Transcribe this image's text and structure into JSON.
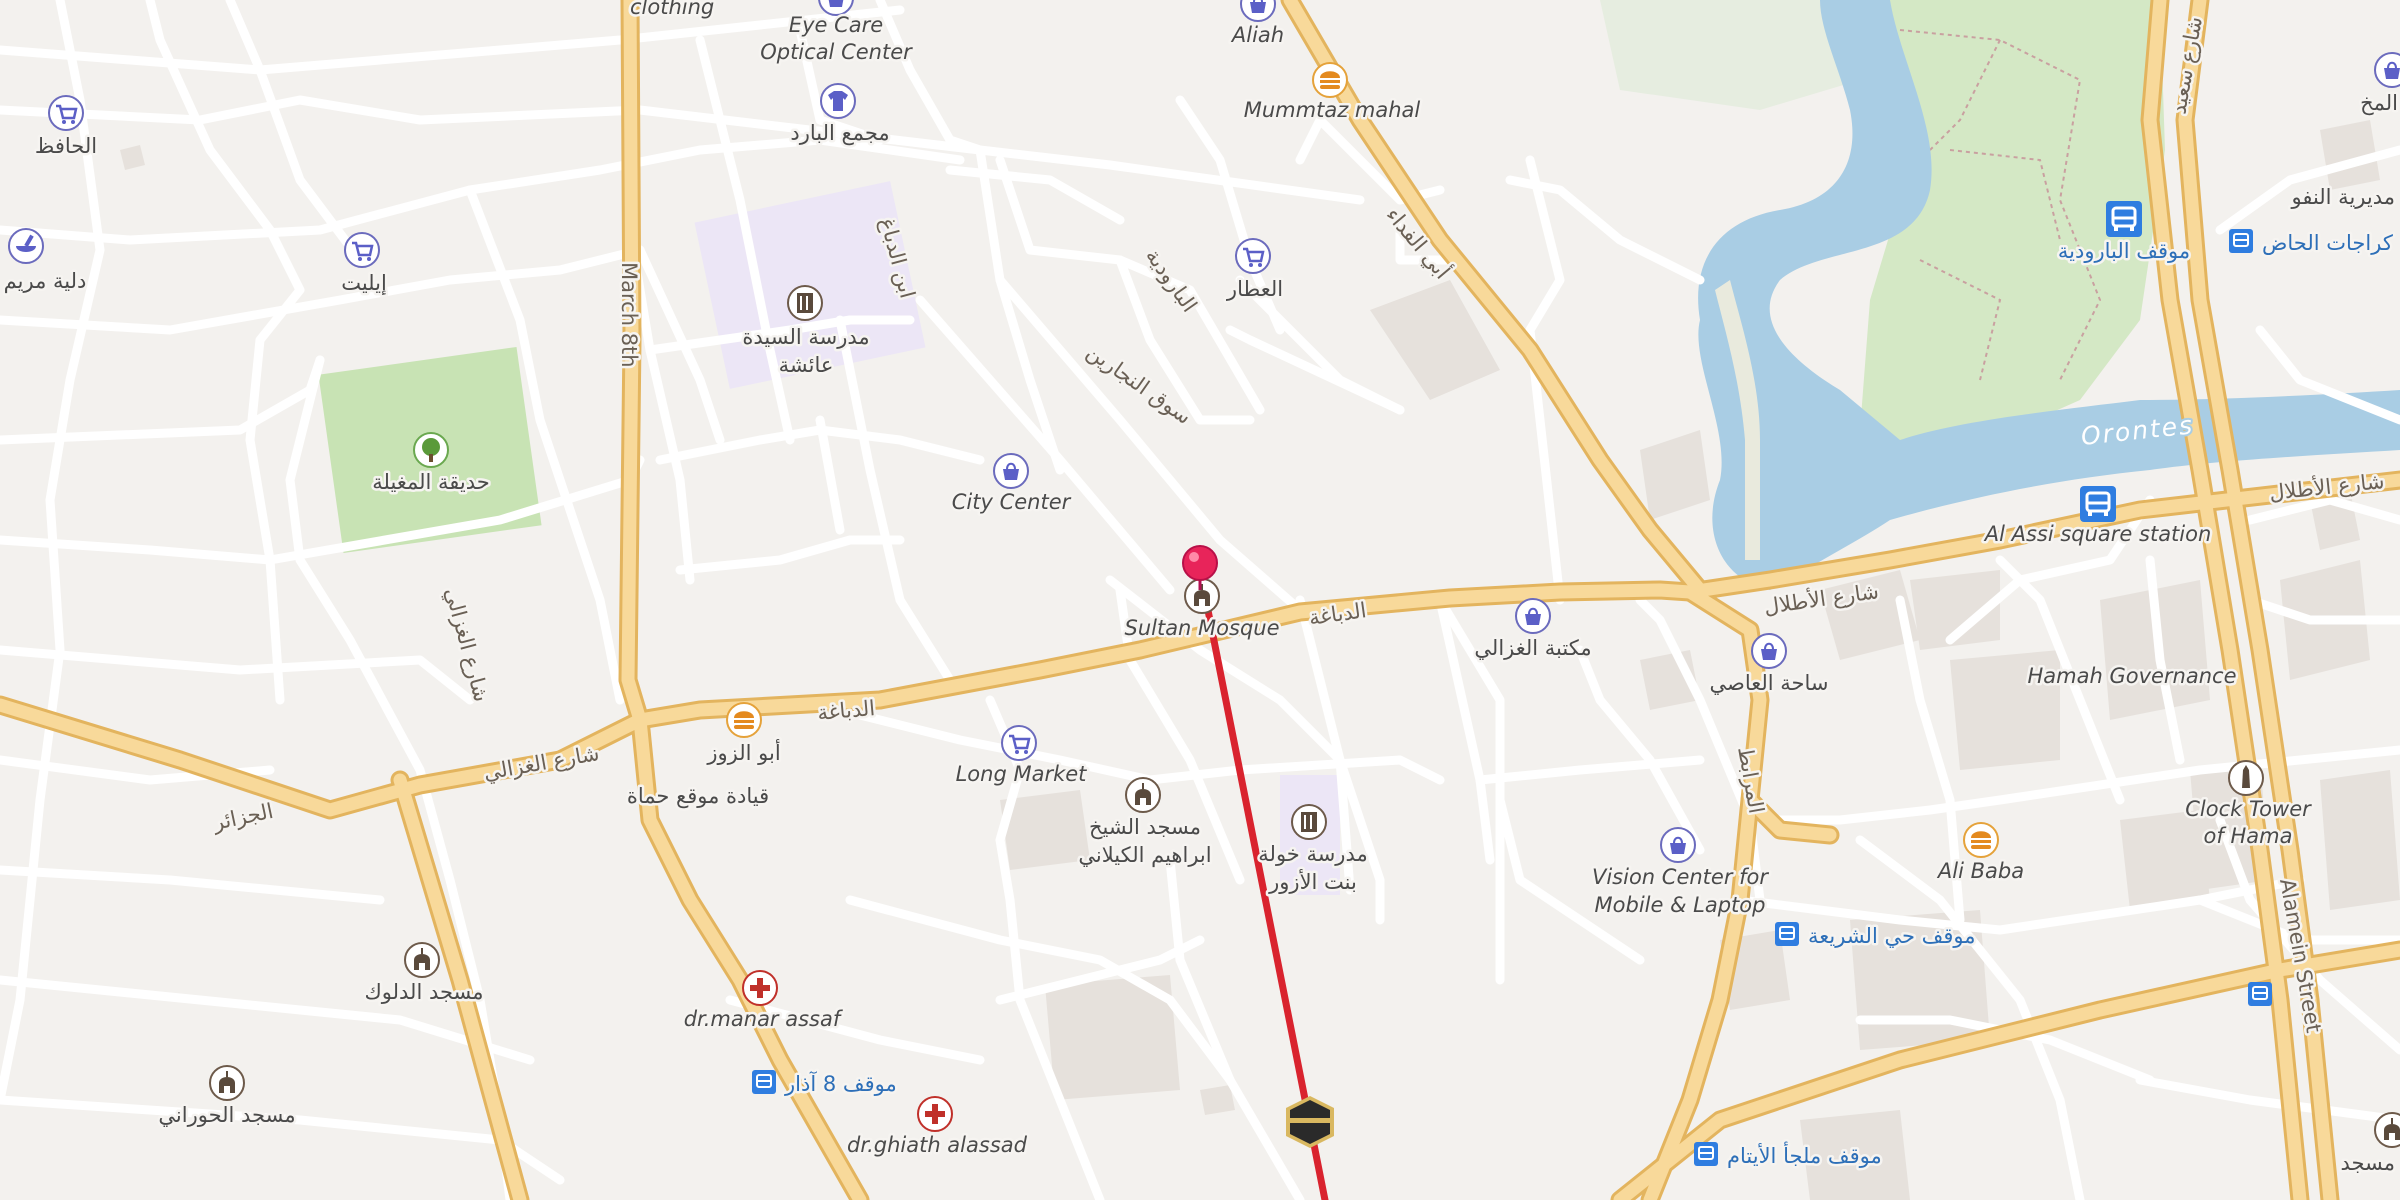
{
  "map": {
    "streets": {
      "march_8th": "March 8th",
      "alamein": "Alamein Street",
      "al_dabbagha_1": "الدباغة",
      "al_dabbagha_2": "الدباغة",
      "shari_al_ghazali": "شارع الغزالي",
      "al_jazair": "الجزائر",
      "shari_al_atlal_1": "شارع الأطلال",
      "shari_al_atlal_2": "شارع الأطلال",
      "suq_al_najjarin": "سوق النجارين",
      "al_marabit": "المرابط",
      "shari_al_ghazali_v": "شارع الغزالي",
      "abi_al_fida": "أبي الفداء",
      "al_barudiya": "البارودية",
      "bin_al_dabbagh": "ابن الدباغ",
      "shari_saeed": "شارع سعيد"
    },
    "water": {
      "orontes": "Orontes"
    },
    "pois": [
      {
        "id": "clothing",
        "label": "clothing",
        "icon": "shirt-icon"
      },
      {
        "id": "eye-care",
        "label": "Eye Care\nOptical Center",
        "icon": "shopping-bag-icon"
      },
      {
        "id": "aliah",
        "label": "Aliah",
        "icon": "shopping-bag-icon"
      },
      {
        "id": "mummtaz",
        "label": "Mummtaz mahal",
        "icon": "burger-icon"
      },
      {
        "id": "al-hafiz",
        "label": "الحافظ",
        "icon": "shopping-cart-icon"
      },
      {
        "id": "majma-al-bara",
        "label": "مجمع البارد",
        "icon": "shirt-icon"
      },
      {
        "id": "pharmacy-mariam",
        "label": "دلية مريم",
        "icon": "mortar-pestle-icon"
      },
      {
        "id": "elite",
        "label": "إيليت",
        "icon": "shopping-cart-icon"
      },
      {
        "id": "school-aisha",
        "label": "مدرسة السيدة\nعائشة",
        "icon": "school-icon"
      },
      {
        "id": "al-attar",
        "label": "العطار",
        "icon": "shopping-cart-icon"
      },
      {
        "id": "park-mughila",
        "label": "حديقة المغيلة",
        "icon": "tree-icon"
      },
      {
        "id": "city-center",
        "label": "City Center",
        "icon": "shopping-bag-icon"
      },
      {
        "id": "sultan-mosque",
        "label": "Sultan Mosque",
        "icon": "mosque-icon"
      },
      {
        "id": "ghazali-bookstore",
        "label": "مكتبة الغزالي",
        "icon": "shopping-bag-icon"
      },
      {
        "id": "al-assi-square",
        "label": "ساحة العاصي",
        "icon": "shopping-bag-icon"
      },
      {
        "id": "abu-al-zuz",
        "label": "أبو الزوز",
        "icon": "burger-icon"
      },
      {
        "id": "long-market",
        "label": "Long Market",
        "icon": "shopping-cart-icon"
      },
      {
        "id": "hama-command",
        "label": "قيادة موقع حماة",
        "icon": ""
      },
      {
        "id": "mosque-kilani",
        "label": "مسجد الشيخ\nابراهيم الكيلاني",
        "icon": "mosque-icon"
      },
      {
        "id": "school-khawla",
        "label": "مدرسة خولة\nبنت الأزور",
        "icon": "school-icon"
      },
      {
        "id": "vision-center",
        "label": "Vision Center for\nMobile & Laptop",
        "icon": "shopping-bag-icon"
      },
      {
        "id": "ali-baba",
        "label": "Ali Baba",
        "icon": "burger-icon"
      },
      {
        "id": "hamah-governance",
        "label": "Hamah Governance",
        "icon": ""
      },
      {
        "id": "clock-tower",
        "label": "Clock Tower\nof Hama",
        "icon": "monument-icon"
      },
      {
        "id": "mosque-dalluk",
        "label": "مسجد الدلوك",
        "icon": "mosque-icon"
      },
      {
        "id": "dr-manar",
        "label": "dr.manar assaf",
        "icon": "medical-cross-icon"
      },
      {
        "id": "mosque-hourani",
        "label": "مسجد الحوراني",
        "icon": "mosque-icon"
      },
      {
        "id": "dr-ghiath",
        "label": "dr.ghiath alassad",
        "icon": "medical-cross-icon"
      },
      {
        "id": "directorate",
        "label": "مديرية النفو",
        "icon": ""
      },
      {
        "id": "masjid-right",
        "label": "مسجد",
        "icon": "mosque-icon"
      },
      {
        "id": "al-makh",
        "label": "المخ",
        "icon": "shopping-bag-icon"
      }
    ],
    "stops": [
      {
        "id": "stop-barudiya",
        "label": "موقف البارودية"
      },
      {
        "id": "stop-garages",
        "label": "كراجات الحاض"
      },
      {
        "id": "stop-al-assi",
        "label": "Al Assi square station"
      },
      {
        "id": "stop-shariaa",
        "label": "موقف حي الشريعة"
      },
      {
        "id": "stop-8-adhar",
        "label": "موقف 8 آذار"
      },
      {
        "id": "stop-orphans",
        "label": "موقف ملجأ الأيتام"
      }
    ],
    "route": {
      "pin": "location-pin-icon",
      "destination": "kaaba-icon",
      "color": "#d9232e"
    }
  }
}
